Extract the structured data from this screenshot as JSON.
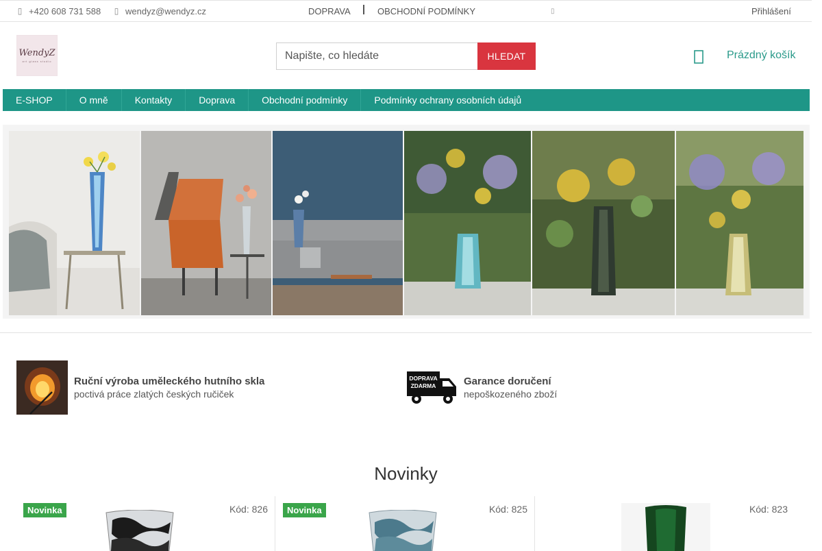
{
  "topbar": {
    "phone": "+420 608 731 588",
    "email": "wendyz@wendyz.cz",
    "links": [
      "DOPRAVA",
      "OBCHODNÍ PODMÍNKY"
    ],
    "login": "Přihlášení"
  },
  "logo": {
    "text": "WendyZ",
    "sub": "art glass studio"
  },
  "search": {
    "placeholder": "Napište, co hledáte",
    "button": "HLEDAT"
  },
  "cart": {
    "label": "Prázdný košík"
  },
  "nav": [
    "E-SHOP",
    "O mně",
    "Kontakty",
    "Doprava",
    "Obchodní podmínky",
    "Podmínky ochrany osobních údajů"
  ],
  "benefits": [
    {
      "title": "Ruční výroba uměleckého hutního skla",
      "subtitle": "poctivá práce zlatých českých ručiček"
    },
    {
      "title": "Garance doručení",
      "subtitle": "nepoškozeného zboží",
      "icon_text": [
        "DOPRAVA",
        "ZDARMA"
      ]
    }
  ],
  "section": {
    "title": "Novinky"
  },
  "products": [
    {
      "badge": "Novinka",
      "code": "Kód: 826"
    },
    {
      "badge": "Novinka",
      "code": "Kód: 825"
    },
    {
      "badge": "",
      "code": "Kód: 823"
    }
  ],
  "colors": {
    "accent": "#1e9687",
    "button": "#d9353f",
    "badge": "#3aa54a",
    "cart": "#2a9a8a"
  }
}
